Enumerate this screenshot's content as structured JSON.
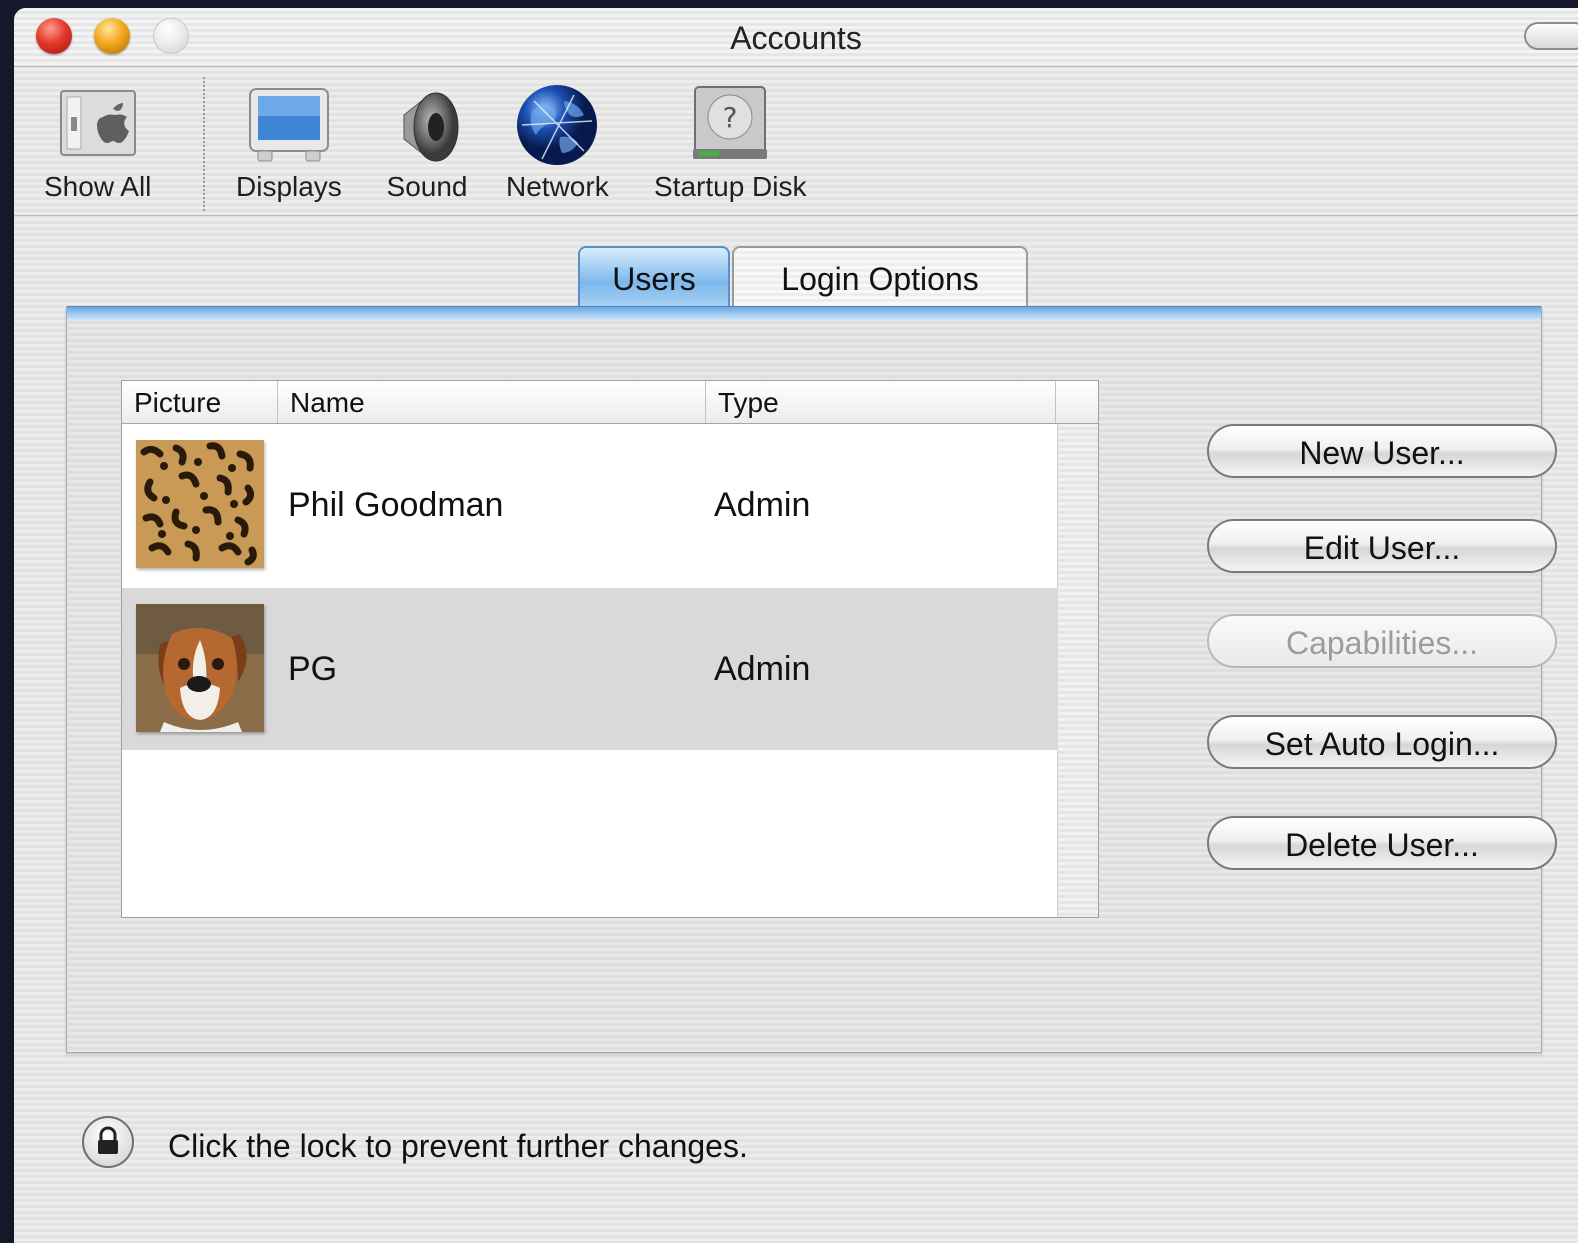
{
  "window": {
    "title": "Accounts"
  },
  "toolbar": {
    "items": [
      {
        "label": "Show All",
        "icon": "show-all-icon"
      },
      {
        "label": "Displays",
        "icon": "displays-icon"
      },
      {
        "label": "Sound",
        "icon": "sound-icon"
      },
      {
        "label": "Network",
        "icon": "network-icon"
      },
      {
        "label": "Startup Disk",
        "icon": "startup-disk-icon"
      }
    ]
  },
  "tabs": [
    {
      "label": "Users",
      "selected": true
    },
    {
      "label": "Login Options",
      "selected": false
    }
  ],
  "users_table": {
    "columns": [
      "Picture",
      "Name",
      "Type"
    ],
    "rows": [
      {
        "picture": "leopard-avatar",
        "name": "Phil Goodman",
        "type": "Admin",
        "selected": false
      },
      {
        "picture": "dog-avatar",
        "name": "PG",
        "type": "Admin",
        "selected": true
      }
    ]
  },
  "actions": {
    "new_user": "New User...",
    "edit_user": "Edit User...",
    "capabilities": "Capabilities...",
    "set_auto_login": "Set Auto Login...",
    "delete_user": "Delete User..."
  },
  "footer": {
    "lock_text": "Click the lock to prevent further changes."
  },
  "colors": {
    "tab_active": "#7cb8ec",
    "selection": "#d9d9d9",
    "close": "#e4382a",
    "minimize": "#f3a81c"
  }
}
